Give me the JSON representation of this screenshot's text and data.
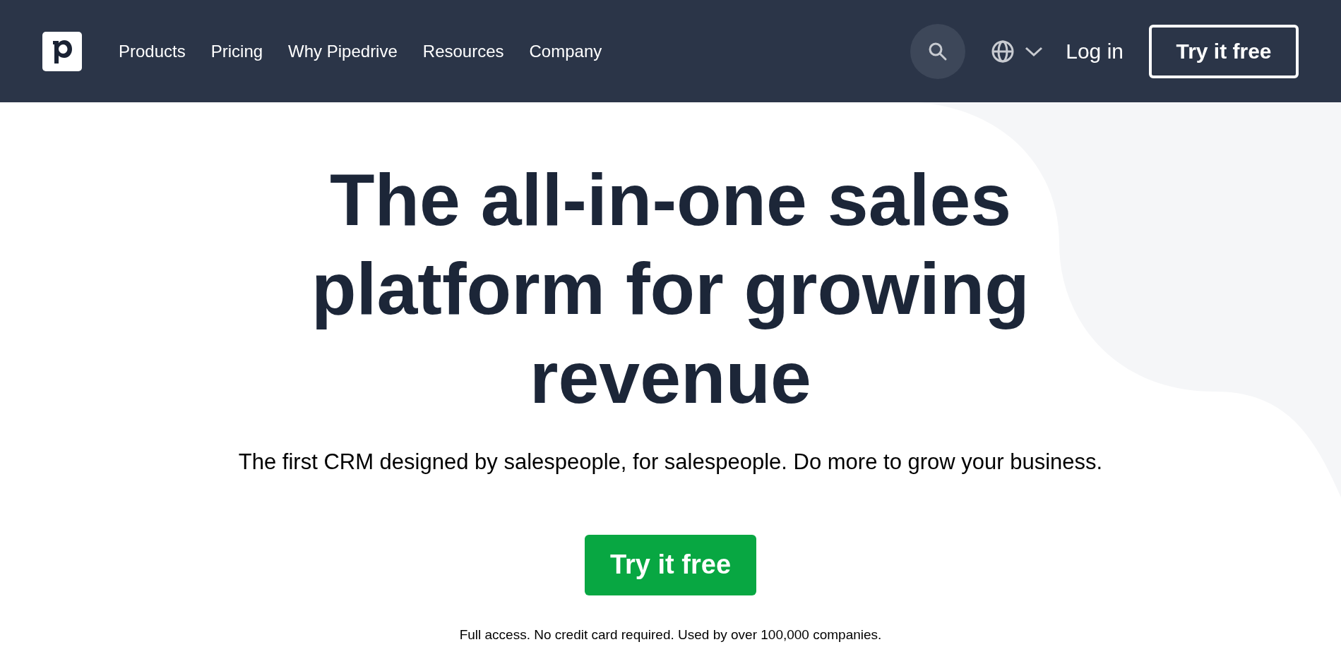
{
  "nav": {
    "links": [
      "Products",
      "Pricing",
      "Why Pipedrive",
      "Resources",
      "Company"
    ],
    "login": "Log in",
    "cta": "Try it free"
  },
  "hero": {
    "title": "The all-in-one sales platform for growing revenue",
    "subtitle": "The first CRM designed by salespeople, for salespeople. Do more to grow your business.",
    "cta": "Try it free",
    "note": "Full access. No credit card required. Used by over 100,000 companies."
  }
}
